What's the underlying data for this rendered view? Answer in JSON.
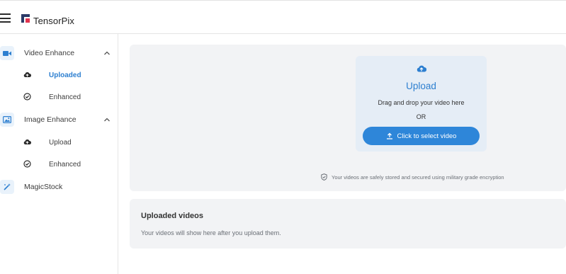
{
  "app": {
    "name": "TensorPix"
  },
  "sidebar": {
    "groups": [
      {
        "label": "Video Enhance",
        "items": [
          {
            "label": "Uploaded",
            "active": true,
            "icon": "cloud-upload-icon"
          },
          {
            "label": "Enhanced",
            "active": false,
            "icon": "check-circle-icon"
          }
        ]
      },
      {
        "label": "Image Enhance",
        "items": [
          {
            "label": "Upload",
            "active": false,
            "icon": "cloud-upload-icon"
          },
          {
            "label": "Enhanced",
            "active": false,
            "icon": "check-circle-icon"
          }
        ]
      },
      {
        "label": "MagicStock",
        "items": []
      }
    ]
  },
  "upload": {
    "title": "Upload",
    "hint": "Drag and drop your video here",
    "or": "OR",
    "button": "Click to select video",
    "security_note": "Your videos are safely stored and secured using military grade encryption"
  },
  "uploaded": {
    "title": "Uploaded videos",
    "empty": "Your videos will show here after you upload them."
  },
  "colors": {
    "accent": "#2e86d9",
    "panel": "#f2f3f5",
    "dropzone": "#e5edf6"
  }
}
